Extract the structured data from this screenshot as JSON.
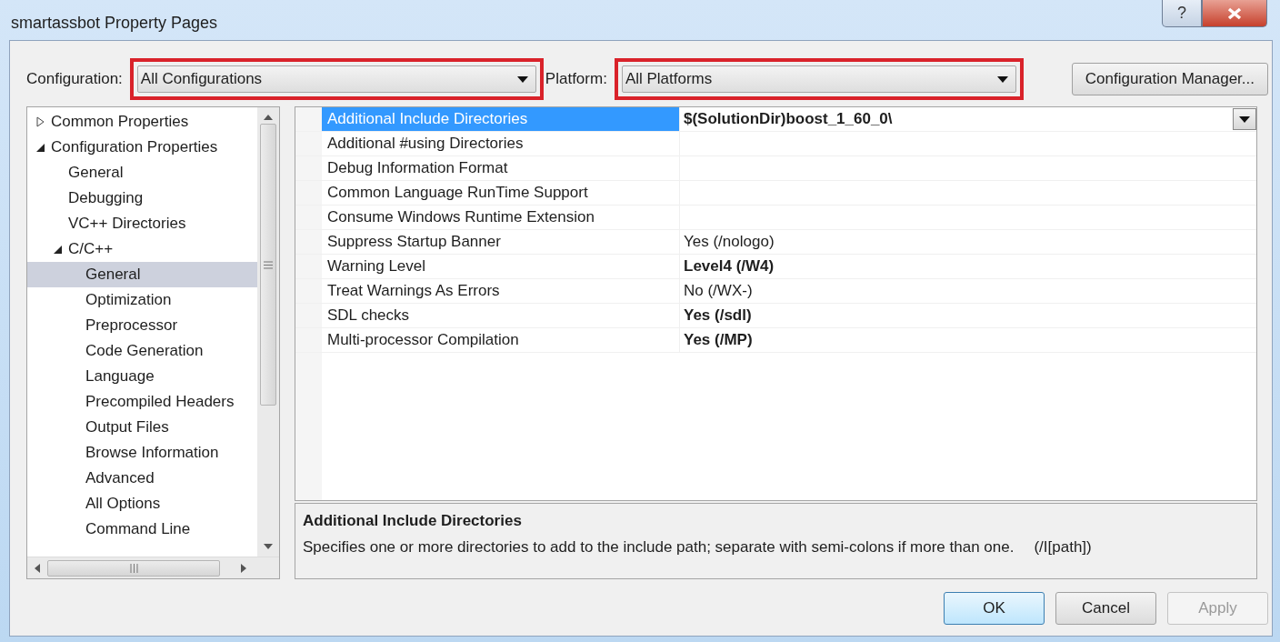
{
  "window": {
    "title": "smartassbot Property Pages",
    "help_glyph": "?"
  },
  "configuration": {
    "label": "Configuration:",
    "value": "All Configurations",
    "highlighted": true
  },
  "platform": {
    "label": "Platform:",
    "value": "All Platforms",
    "highlighted": true
  },
  "config_manager_button": "Configuration Manager...",
  "tree": [
    {
      "label": "Common Properties",
      "expanded": false,
      "selected": false
    },
    {
      "label": "Configuration Properties",
      "expanded": true,
      "selected": false,
      "children": [
        {
          "label": "General",
          "selected": false
        },
        {
          "label": "Debugging",
          "selected": false
        },
        {
          "label": "VC++ Directories",
          "selected": false
        },
        {
          "label": "C/C++",
          "expanded": true,
          "selected": false,
          "children": [
            {
              "label": "General",
              "selected": true
            },
            {
              "label": "Optimization",
              "selected": false
            },
            {
              "label": "Preprocessor",
              "selected": false
            },
            {
              "label": "Code Generation",
              "selected": false
            },
            {
              "label": "Language",
              "selected": false
            },
            {
              "label": "Precompiled Headers",
              "selected": false
            },
            {
              "label": "Output Files",
              "selected": false
            },
            {
              "label": "Browse Information",
              "selected": false
            },
            {
              "label": "Advanced",
              "selected": false
            },
            {
              "label": "All Options",
              "selected": false
            },
            {
              "label": "Command Line",
              "selected": false
            }
          ]
        }
      ]
    }
  ],
  "properties": [
    {
      "name": "Additional Include Directories",
      "value": "$(SolutionDir)boost_1_60_0\\",
      "bold": true,
      "selected": true
    },
    {
      "name": "Additional #using Directories",
      "selected": false
    },
    {
      "name": "Debug Information Format",
      "selected": false
    },
    {
      "name": "Common Language RunTime Support",
      "selected": false
    },
    {
      "name": "Consume Windows Runtime Extension",
      "selected": false
    },
    {
      "name": "Suppress Startup Banner",
      "value": "Yes (/nologo)",
      "bold": false,
      "selected": false
    },
    {
      "name": "Warning Level",
      "value": "Level4 (/W4)",
      "bold": true,
      "selected": false
    },
    {
      "name": "Treat Warnings As Errors",
      "value": "No (/WX-)",
      "bold": false,
      "selected": false
    },
    {
      "name": "SDL checks",
      "value": "Yes (/sdl)",
      "bold": true,
      "selected": false
    },
    {
      "name": "Multi-processor Compilation",
      "value": "Yes (/MP)",
      "bold": true,
      "selected": false
    }
  ],
  "description": {
    "title": "Additional Include Directories",
    "text": "Specifies one or more directories to add to the include path; separate with semi-colons if more than one.",
    "switch": "(/I[path])"
  },
  "buttons": [
    {
      "label": "OK",
      "kind": "default",
      "disabled": false
    },
    {
      "label": "Cancel",
      "kind": "normal",
      "disabled": false
    },
    {
      "label": "Apply",
      "kind": "normal",
      "disabled": true
    }
  ]
}
